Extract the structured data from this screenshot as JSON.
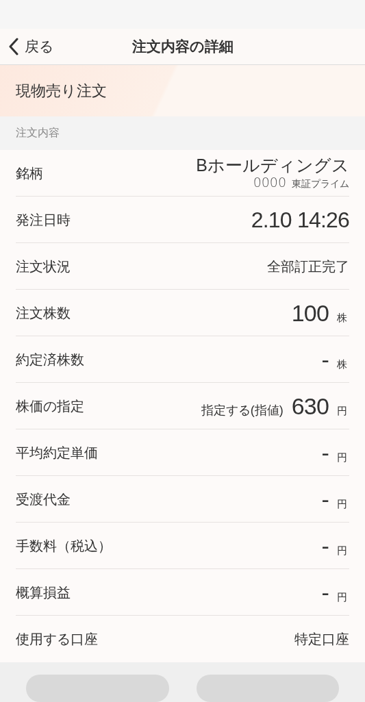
{
  "header": {
    "back_label": "戻る",
    "title": "注文内容の詳細"
  },
  "order_type": "現物売り注文",
  "section_title": "注文内容",
  "rows": [
    {
      "kind": "stock",
      "label": "銘柄",
      "name": "Bホールディングス",
      "code": "0000",
      "market": "東証プライム"
    },
    {
      "kind": "large",
      "label": "発注日時",
      "value": "2.10 14:26"
    },
    {
      "kind": "text",
      "label": "注文状況",
      "value": "全部訂正完了"
    },
    {
      "kind": "number",
      "label": "注文株数",
      "value": "100",
      "unit": "株"
    },
    {
      "kind": "number",
      "label": "約定済株数",
      "value": "-",
      "unit": "株"
    },
    {
      "kind": "number",
      "label": "株価の指定",
      "prefix": "指定する(指値)",
      "value": "630",
      "unit": "円"
    },
    {
      "kind": "number",
      "label": "平均約定単価",
      "value": "-",
      "unit": "円"
    },
    {
      "kind": "number",
      "label": "受渡代金",
      "value": "-",
      "unit": "円"
    },
    {
      "kind": "number",
      "label": "手数料（税込）",
      "value": "-",
      "unit": "円"
    },
    {
      "kind": "number",
      "label": "概算損益",
      "value": "-",
      "unit": "円"
    },
    {
      "kind": "text",
      "label": "使用する口座",
      "value": "特定口座"
    }
  ]
}
